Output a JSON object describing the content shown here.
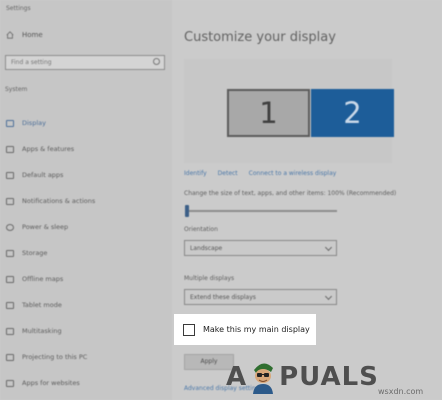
{
  "window": {
    "title": "Settings"
  },
  "sidebar": {
    "home_label": "Home",
    "search_placeholder": "Find a setting",
    "section_label": "System",
    "items": [
      {
        "label": "Display",
        "icon": "monitor-icon",
        "active": true
      },
      {
        "label": "Apps & features",
        "icon": "apps-icon"
      },
      {
        "label": "Default apps",
        "icon": "default-apps-icon"
      },
      {
        "label": "Notifications & actions",
        "icon": "notifications-icon"
      },
      {
        "label": "Power & sleep",
        "icon": "power-icon"
      },
      {
        "label": "Storage",
        "icon": "storage-icon"
      },
      {
        "label": "Offline maps",
        "icon": "map-icon"
      },
      {
        "label": "Tablet mode",
        "icon": "tablet-icon"
      },
      {
        "label": "Multitasking",
        "icon": "multitasking-icon"
      },
      {
        "label": "Projecting to this PC",
        "icon": "projecting-icon"
      },
      {
        "label": "Apps for websites",
        "icon": "websites-icon"
      }
    ]
  },
  "main": {
    "title": "Customize your display",
    "monitors": [
      "1",
      "2"
    ],
    "selected_monitor": "2",
    "links": {
      "identify": "Identify",
      "detect": "Detect",
      "connect": "Connect to a wireless display"
    },
    "scale_label": "Change the size of text, apps, and other items: 100% (Recommended)",
    "scale_value": 0,
    "orientation_label": "Orientation",
    "orientation_value": "Landscape",
    "multiple_displays_label": "Multiple displays",
    "multiple_displays_value": "Extend these displays",
    "main_display_checkbox": "Make this my main display",
    "main_display_checked": false,
    "apply_label": "Apply",
    "advanced_link": "Advanced display settings"
  },
  "watermark": {
    "logo_a": "A",
    "logo_rest": "PUALS",
    "site": "wsxdn.com"
  },
  "colors": {
    "accent": "#1d5d99",
    "link": "#4a77a8",
    "highlight": "#ffffff"
  }
}
